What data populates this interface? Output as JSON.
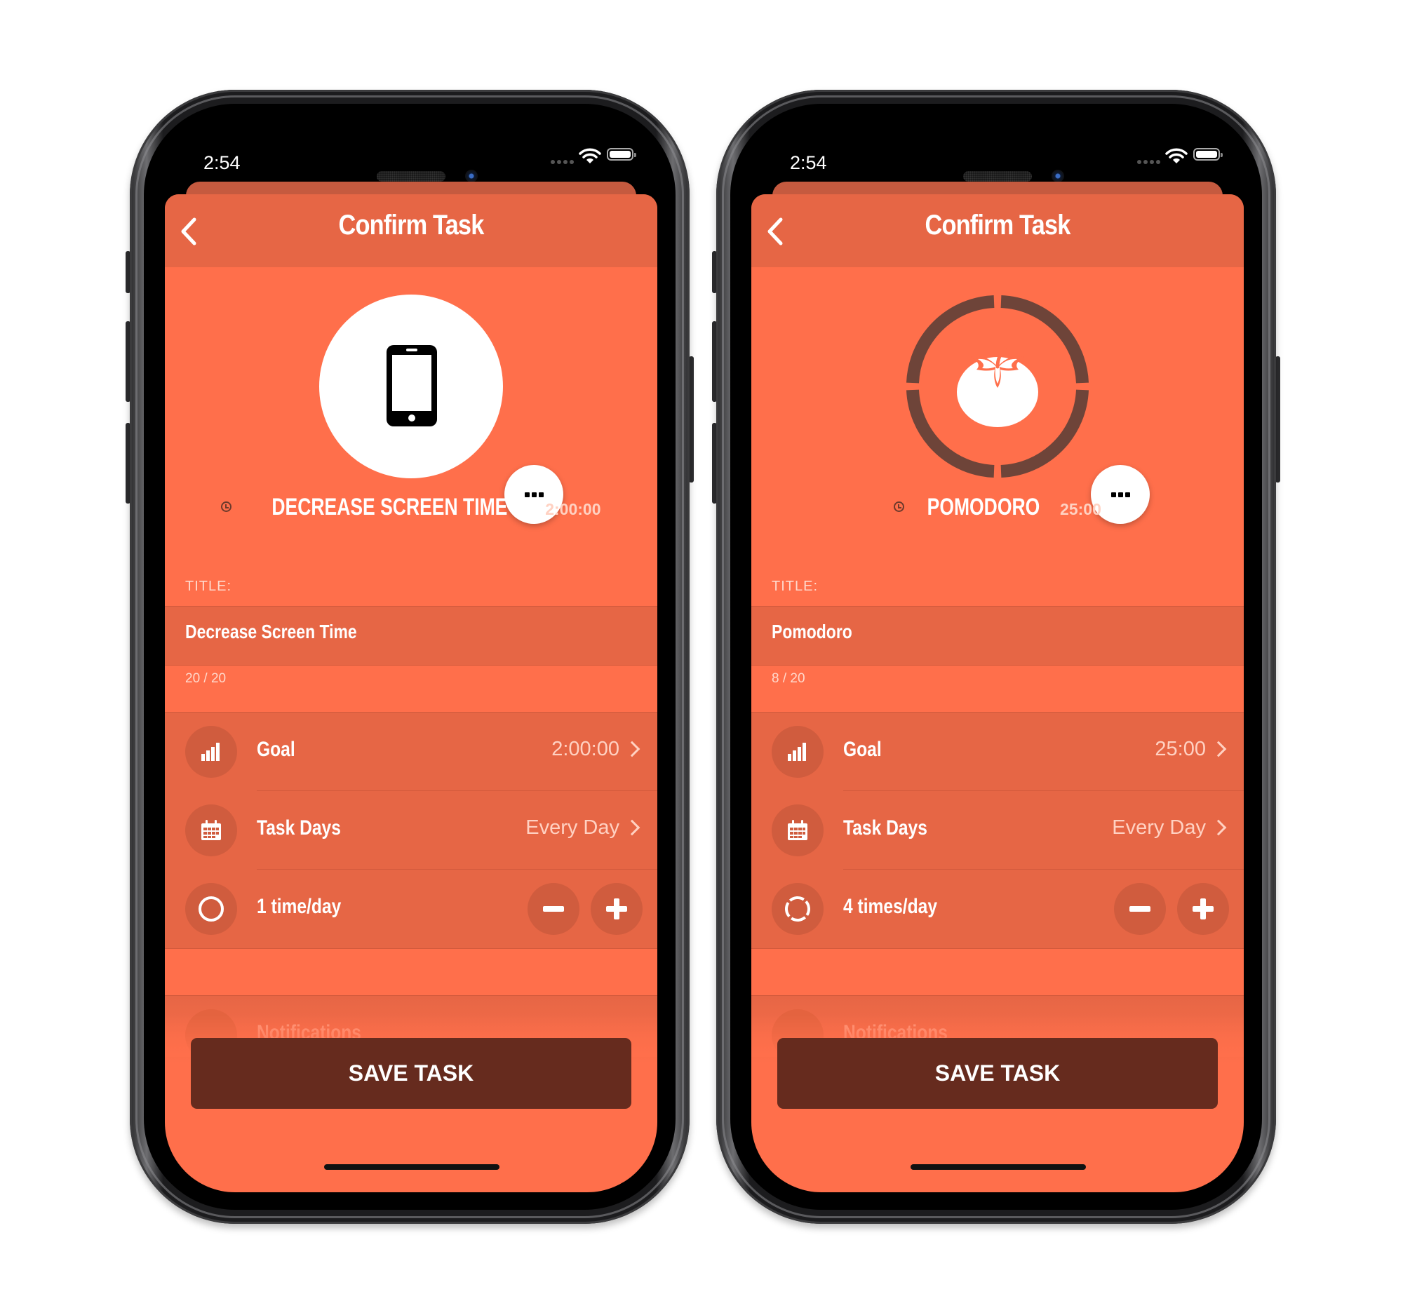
{
  "phones": [
    {
      "status_bar": {
        "time": "2:54",
        "signal_icon": "signal-dots-icon",
        "wifi_icon": "wifi-icon",
        "battery_icon": "battery-icon"
      },
      "header": {
        "title": "Confirm Task",
        "back_icon": "chevron-left-icon"
      },
      "hero": {
        "icon": "smartphone-icon",
        "more_icon": "ellipsis-icon"
      },
      "task_name": {
        "clock_icon": "clock-icon",
        "name": "DECREASE SCREEN TIME",
        "duration": "2:00:00"
      },
      "title_field": {
        "label": "TITLE:",
        "value": "Decrease Screen Time",
        "counter": "20 / 20"
      },
      "rows": [
        {
          "icon": "bar-chart-icon",
          "label": "Goal",
          "value": "2:00:00"
        },
        {
          "icon": "calendar-icon",
          "label": "Task Days",
          "value": "Every Day"
        },
        {
          "icon": "circle-icon",
          "label": "1 time/day"
        }
      ],
      "notifications": {
        "icon": "clock-icon",
        "label": "Notifications"
      },
      "save_label": "SAVE TASK"
    },
    {
      "status_bar": {
        "time": "2:54",
        "signal_icon": "signal-dots-icon",
        "wifi_icon": "wifi-icon",
        "battery_icon": "battery-icon"
      },
      "header": {
        "title": "Confirm Task",
        "back_icon": "chevron-left-icon"
      },
      "hero": {
        "icon": "tomato-icon",
        "more_icon": "ellipsis-icon",
        "ring_segments": 4
      },
      "task_name": {
        "clock_icon": "clock-icon",
        "name": "POMODORO",
        "duration": "25:00"
      },
      "title_field": {
        "label": "TITLE:",
        "value": "Pomodoro",
        "counter": "8 / 20"
      },
      "rows": [
        {
          "icon": "bar-chart-icon",
          "label": "Goal",
          "value": "25:00"
        },
        {
          "icon": "calendar-icon",
          "label": "Task Days",
          "value": "Every Day"
        },
        {
          "icon": "segmented-circle-icon",
          "label": "4 times/day"
        }
      ],
      "notifications": {
        "icon": "clock-icon",
        "label": "Notifications"
      },
      "save_label": "SAVE TASK"
    }
  ],
  "colors": {
    "background": "#ff6f4b",
    "header": "#e66645",
    "icon_circle": "#d05c3e",
    "save_button": "#662b1e",
    "ring": "#6e4439"
  }
}
